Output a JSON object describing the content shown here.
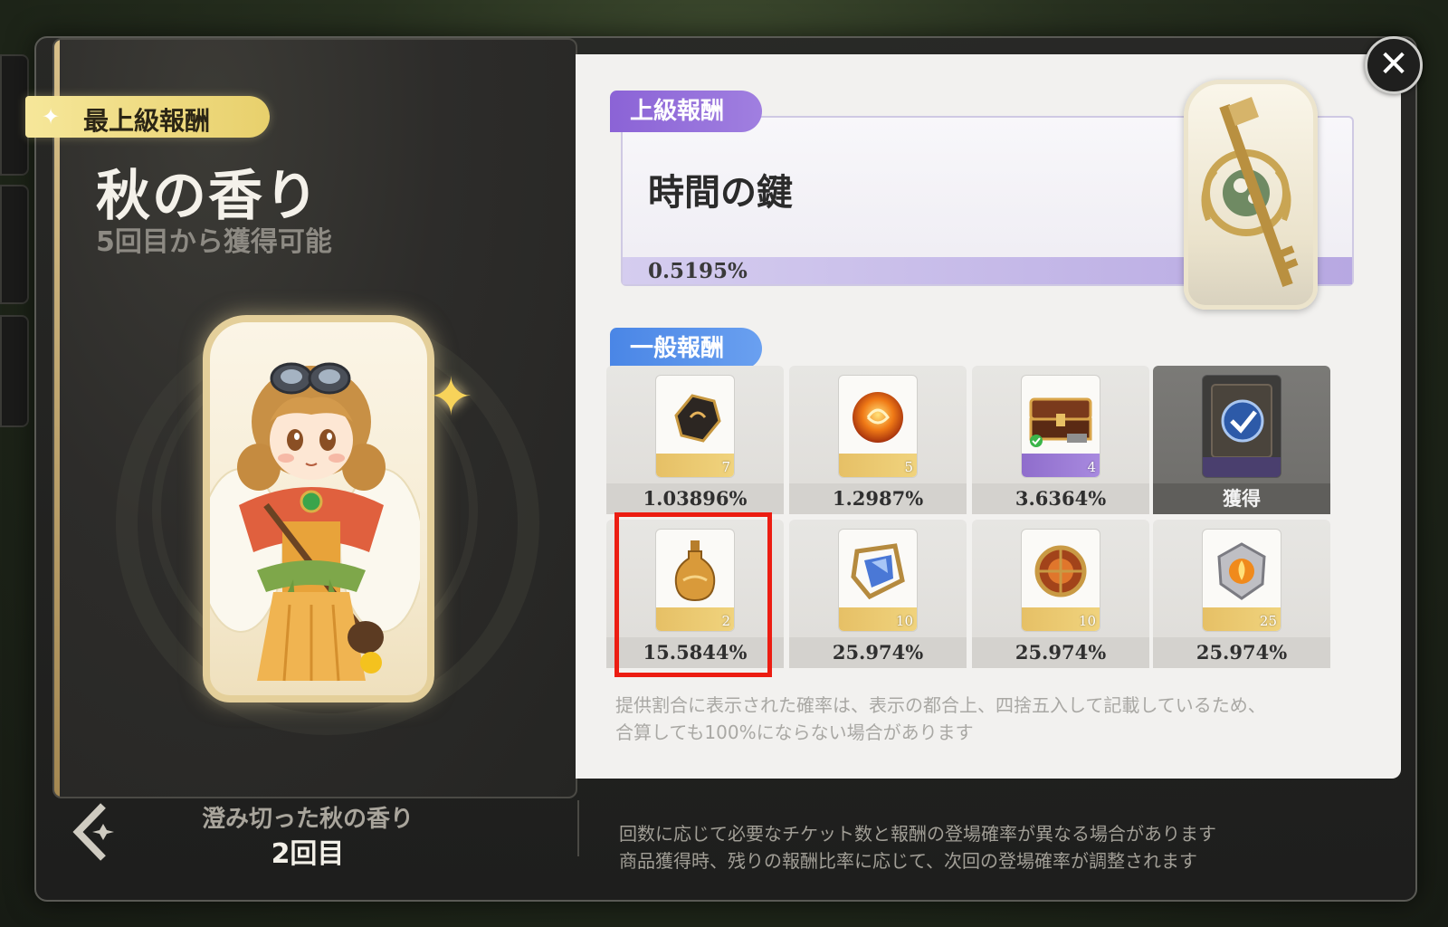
{
  "window": {
    "close_icon": "close-icon"
  },
  "left_panel": {
    "tier_badge": "最上級報酬",
    "title": "秋の香り",
    "subtitle": "5回目から獲得可能"
  },
  "nav": {
    "back_icon": "back-arrow-icon",
    "item_name": "澄み切った秋の香り",
    "count": "2回目"
  },
  "bottom_note": {
    "line1": "回数に応じて必要なチケット数と報酬の登場確率が異なる場合があります",
    "line2": "商品獲得時、残りの報酬比率に応じて、次回の登場確率が調整されます"
  },
  "premium": {
    "section_label": "上級報酬",
    "name": "時間の鍵",
    "percent": "0.5195%"
  },
  "general": {
    "section_label": "一般報酬",
    "items": [
      {
        "icon": "dark-crystal-icon",
        "qty": "7",
        "percent": "1.03896%"
      },
      {
        "icon": "fire-orb-icon",
        "qty": "5",
        "percent": "1.2987%"
      },
      {
        "icon": "treasure-chest-icon",
        "qty": "4",
        "percent": "3.6364%"
      },
      {
        "icon": "checked-scroll-icon",
        "qty": "",
        "percent": "獲得"
      },
      {
        "icon": "golden-potion-icon",
        "qty": "2",
        "percent": "15.5844%"
      },
      {
        "icon": "blue-gem-cage-icon",
        "qty": "10",
        "percent": "25.974%"
      },
      {
        "icon": "amber-orb-icon",
        "qty": "10",
        "percent": "25.974%"
      },
      {
        "icon": "fire-crest-icon",
        "qty": "25",
        "percent": "25.974%"
      }
    ]
  },
  "disclaimer": {
    "line1": "提供割合に表示された確率は、表示の都合上、四捨五入して記載しているため、",
    "line2": "合算しても100%にならない場合があります"
  },
  "colors": {
    "highlight": "#ec1d12",
    "premium_accent": "#8b63d6",
    "general_accent": "#4a86e6",
    "gold": "#e6c066"
  }
}
